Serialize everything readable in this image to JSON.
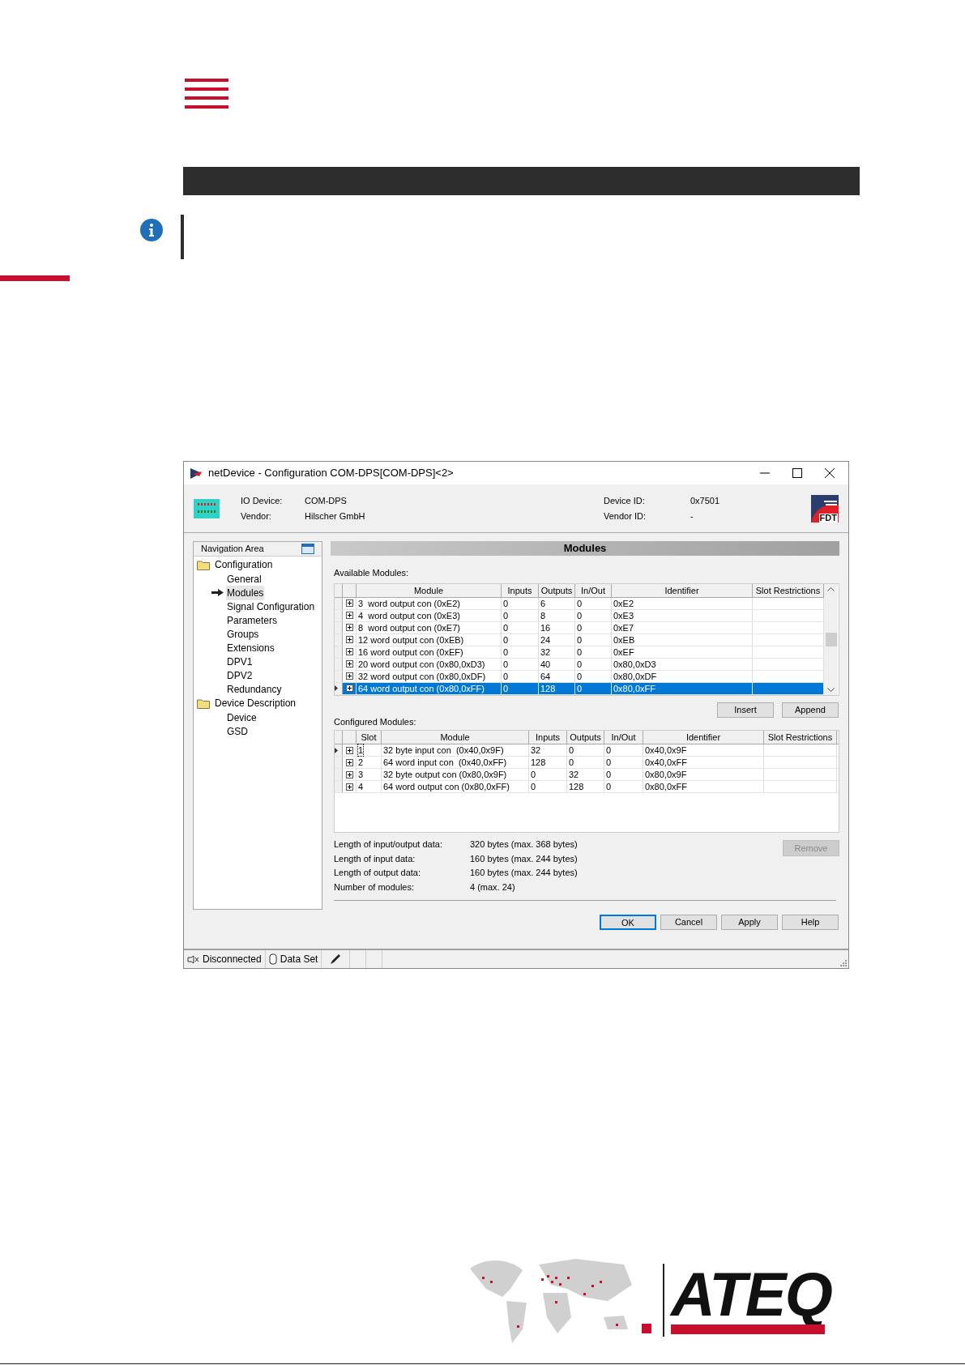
{
  "window": {
    "title": "netDevice - Configuration COM-DPS[COM-DPS]<2>"
  },
  "device_info": {
    "left": [
      {
        "label": "IO Device:",
        "value": "COM-DPS"
      },
      {
        "label": "Vendor:",
        "value": "Hilscher GmbH"
      }
    ],
    "right": [
      {
        "label": "Device ID:",
        "value": "0x7501"
      },
      {
        "label": "Vendor ID:",
        "value": "-"
      }
    ],
    "logo_text": "FDT"
  },
  "navigation": {
    "title": "Navigation Area",
    "items": [
      {
        "label": "Configuration",
        "selected": false,
        "children": [
          {
            "label": "General",
            "selected": false
          },
          {
            "label": "Modules",
            "selected": true
          },
          {
            "label": "Signal Configuration",
            "selected": false
          },
          {
            "label": "Parameters",
            "selected": false
          },
          {
            "label": "Groups",
            "selected": false
          },
          {
            "label": "Extensions",
            "selected": false
          },
          {
            "label": "DPV1",
            "selected": false
          },
          {
            "label": "DPV2",
            "selected": false
          },
          {
            "label": "Redundancy",
            "selected": false
          }
        ]
      },
      {
        "label": "Device Description",
        "selected": false,
        "children": [
          {
            "label": "Device",
            "selected": false
          },
          {
            "label": "GSD",
            "selected": false
          }
        ]
      }
    ]
  },
  "panel_title": "Modules",
  "available_modules": {
    "label": "Available Modules:",
    "columns": [
      "Module",
      "Inputs",
      "Outputs",
      "In/Out",
      "Identifier",
      "Slot Restrictions"
    ],
    "rows": [
      {
        "cells": [
          "3  word output con (0xE2)",
          "0",
          "6",
          "0",
          "0xE2"
        ],
        "selected": false
      },
      {
        "cells": [
          "4  word output con (0xE3)",
          "0",
          "8",
          "0",
          "0xE3"
        ],
        "selected": false
      },
      {
        "cells": [
          "8  word output con (0xE7)",
          "0",
          "16",
          "0",
          "0xE7"
        ],
        "selected": false
      },
      {
        "cells": [
          "12 word output con (0xEB)",
          "0",
          "24",
          "0",
          "0xEB"
        ],
        "selected": false
      },
      {
        "cells": [
          "16 word output con (0xEF)",
          "0",
          "32",
          "0",
          "0xEF"
        ],
        "selected": false
      },
      {
        "cells": [
          "20 word output con (0x80,0xD3)",
          "0",
          "40",
          "0",
          "0x80,0xD3"
        ],
        "selected": false
      },
      {
        "cells": [
          "32 word output con (0x80,0xDF)",
          "0",
          "64",
          "0",
          "0x80,0xDF"
        ],
        "selected": false
      },
      {
        "cells": [
          "64 word output con (0x80,0xFF)",
          "0",
          "128",
          "0",
          "0x80,0xFF"
        ],
        "selected": true
      }
    ]
  },
  "list_buttons": [
    {
      "label": "Insert"
    },
    {
      "label": "Append"
    }
  ],
  "configured_modules": {
    "label": "Configured Modules:",
    "columns": [
      "Slot",
      "Module",
      "Inputs",
      "Outputs",
      "In/Out",
      "Identifier",
      "Slot Restrictions"
    ],
    "rows": [
      {
        "cells": [
          "1",
          "32 byte input con  (0x40,0x9F)",
          "32",
          "0",
          "0",
          "0x40,0x9F"
        ],
        "selected": true
      },
      {
        "cells": [
          "2",
          "64 word input con  (0x40,0xFF)",
          "128",
          "0",
          "0",
          "0x40,0xFF"
        ],
        "selected": false
      },
      {
        "cells": [
          "3",
          "32 byte output con (0x80,0x9F)",
          "0",
          "32",
          "0",
          "0x80,0x9F"
        ],
        "selected": false
      },
      {
        "cells": [
          "4",
          "64 word output con (0x80,0xFF)",
          "0",
          "128",
          "0",
          "0x80,0xFF"
        ],
        "selected": false
      }
    ]
  },
  "summary": [
    {
      "label": "Length of input/output data:",
      "value": "320 bytes (max. 368 bytes)"
    },
    {
      "label": "Length of input data:",
      "value": "160 bytes (max. 244 bytes)"
    },
    {
      "label": "Length of output data:",
      "value": "160 bytes (max. 244 bytes)"
    },
    {
      "label": "Number of modules:",
      "value": "4 (max. 24)"
    }
  ],
  "remove_button": {
    "label": "Remove",
    "disabled": true
  },
  "dialog_buttons": [
    {
      "label": "OK",
      "default": true
    },
    {
      "label": "Cancel",
      "default": false
    },
    {
      "label": "Apply",
      "default": false
    },
    {
      "label": "Help",
      "default": false
    }
  ],
  "status_bar": [
    {
      "kind": "connection",
      "label": "Disconnected"
    },
    {
      "kind": "dataset",
      "label": "Data Set"
    }
  ],
  "brand": {
    "name": "ATEQ"
  }
}
